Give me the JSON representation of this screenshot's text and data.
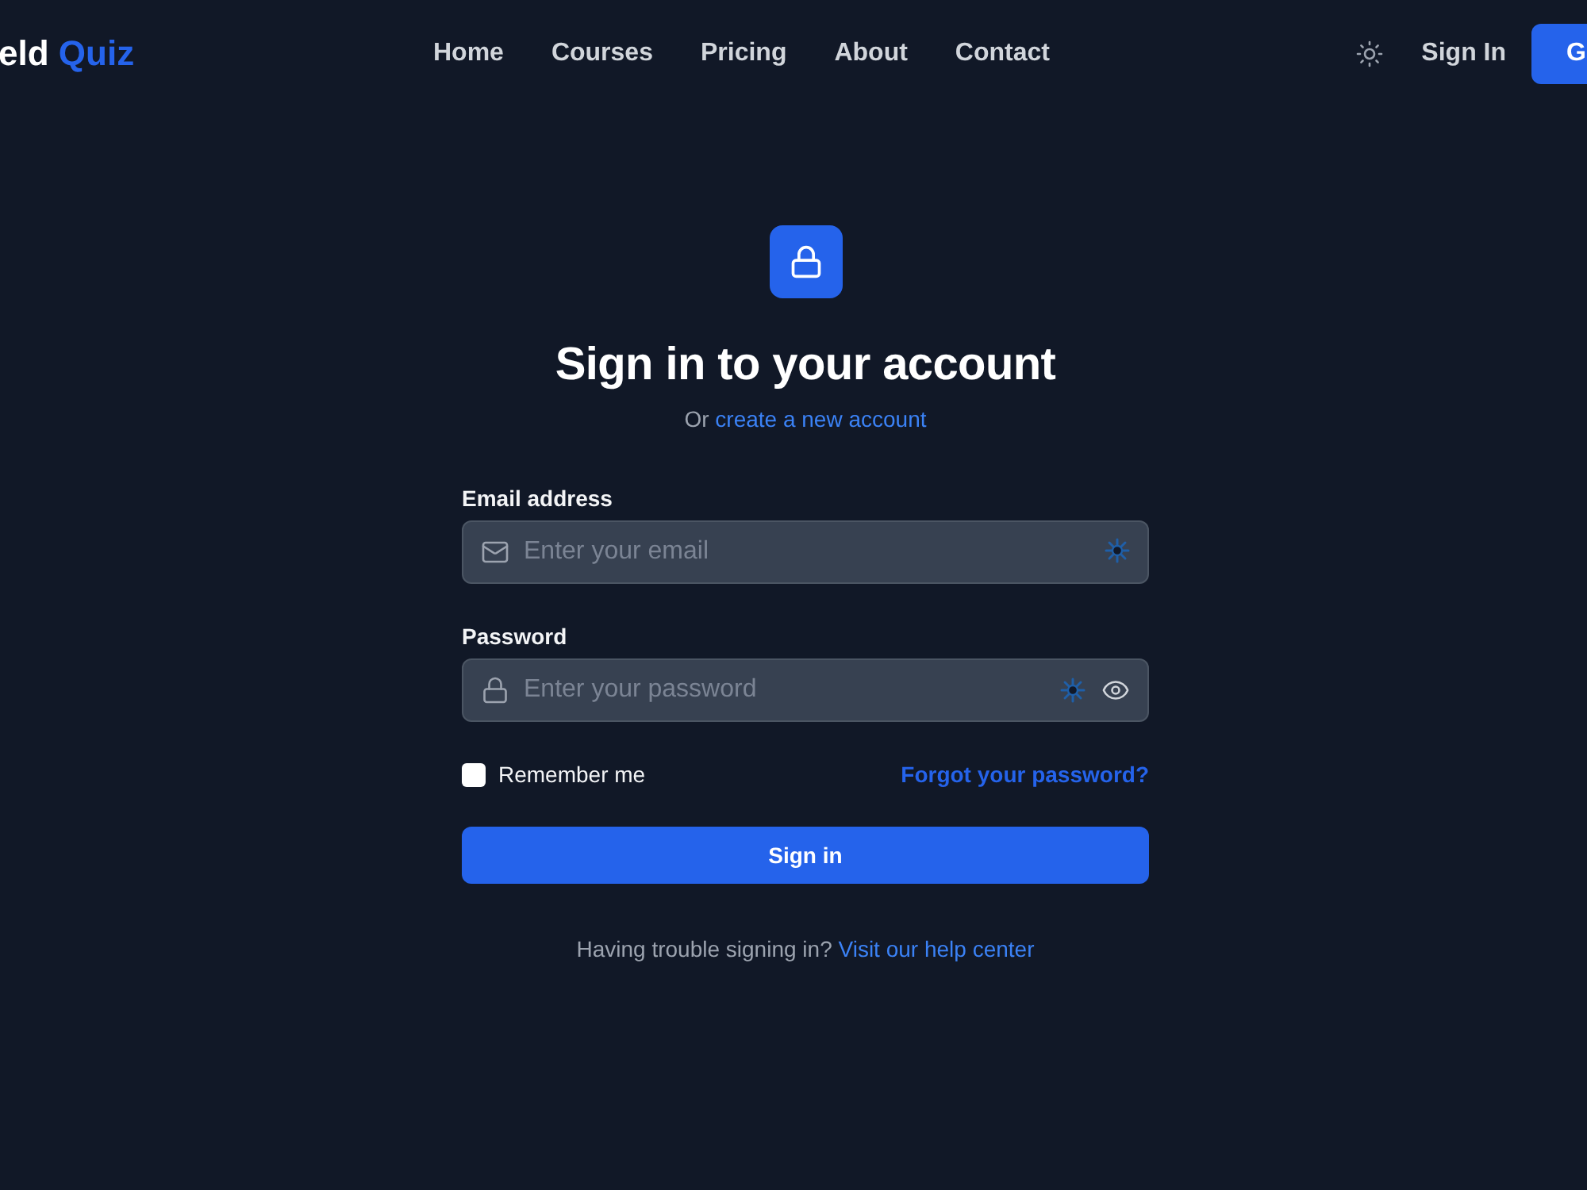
{
  "header": {
    "logo": {
      "part_1": "eld",
      "part_2": "Quiz"
    },
    "nav": [
      {
        "label": "Home"
      },
      {
        "label": "Courses"
      },
      {
        "label": "Pricing"
      },
      {
        "label": "About"
      },
      {
        "label": "Contact"
      }
    ],
    "sign_in": "Sign In",
    "cta": "G"
  },
  "form": {
    "title": "Sign in to your account",
    "subtitle": {
      "prefix": "Or",
      "link": "create a new account"
    },
    "fields": [
      {
        "kind": "email",
        "label": "Email address",
        "placeholder": "Enter your email"
      },
      {
        "kind": "password",
        "label": "Password",
        "placeholder": "Enter your password"
      }
    ],
    "remember": {
      "label": "Remember me",
      "checked": false
    },
    "forgot": "Forgot your password?",
    "submit": "Sign in",
    "help": {
      "text": "Having trouble signing in?",
      "link": "Visit our help center"
    }
  }
}
